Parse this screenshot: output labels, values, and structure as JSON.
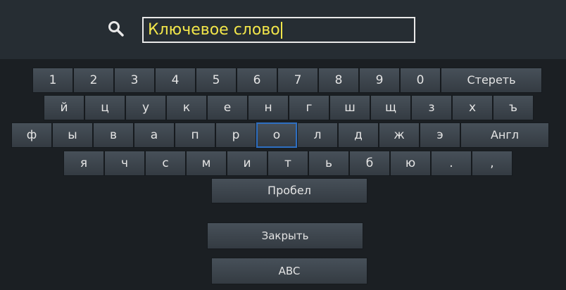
{
  "search": {
    "value": "Ключевое слово"
  },
  "keyboard": {
    "row1": [
      "1",
      "2",
      "3",
      "4",
      "5",
      "6",
      "7",
      "8",
      "9",
      "0"
    ],
    "row1_erase": "Стереть",
    "row2": [
      "й",
      "ц",
      "у",
      "к",
      "е",
      "н",
      "г",
      "ш",
      "щ",
      "з",
      "х",
      "ъ"
    ],
    "row3": [
      "ф",
      "ы",
      "в",
      "а",
      "п",
      "р",
      "о",
      "л",
      "д",
      "ж",
      "э"
    ],
    "row3_lang": "Англ",
    "row4": [
      "я",
      "ч",
      "с",
      "м",
      "и",
      "т",
      "ь",
      "б",
      "ю",
      ".",
      ","
    ],
    "space": "Пробел",
    "close": "Закрыть",
    "abc": "ABC",
    "focused_key": "о"
  },
  "colors": {
    "accent_text": "#f2e64a",
    "focus_border": "#2e6fc2",
    "background": "#1d2227"
  }
}
